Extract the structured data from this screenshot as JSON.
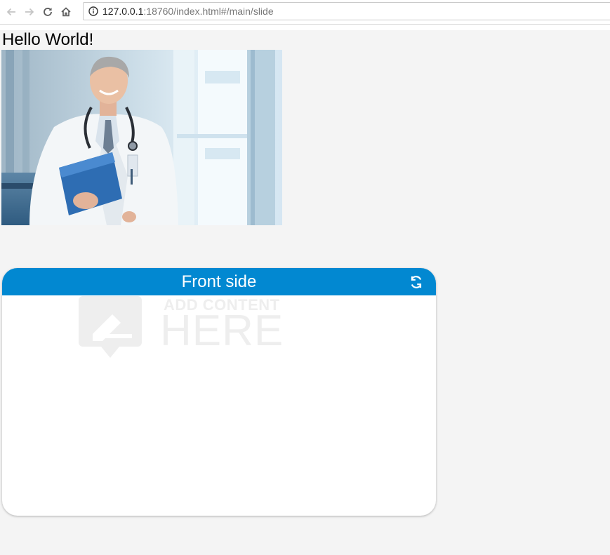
{
  "browser": {
    "url_host": "127.0.0.1",
    "url_rest": ":18760/index.html#/main/slide",
    "icons": [
      "back-arrow-icon",
      "forward-arrow-icon",
      "reload-icon",
      "home-icon",
      "info-icon"
    ]
  },
  "page": {
    "heading": "Hello World!"
  },
  "card": {
    "title": "Front side",
    "placeholder_top": "ADD CONTENT",
    "placeholder_main": "HERE",
    "flip_icon": "flip-refresh-icon",
    "header_color": "#0288d1"
  }
}
